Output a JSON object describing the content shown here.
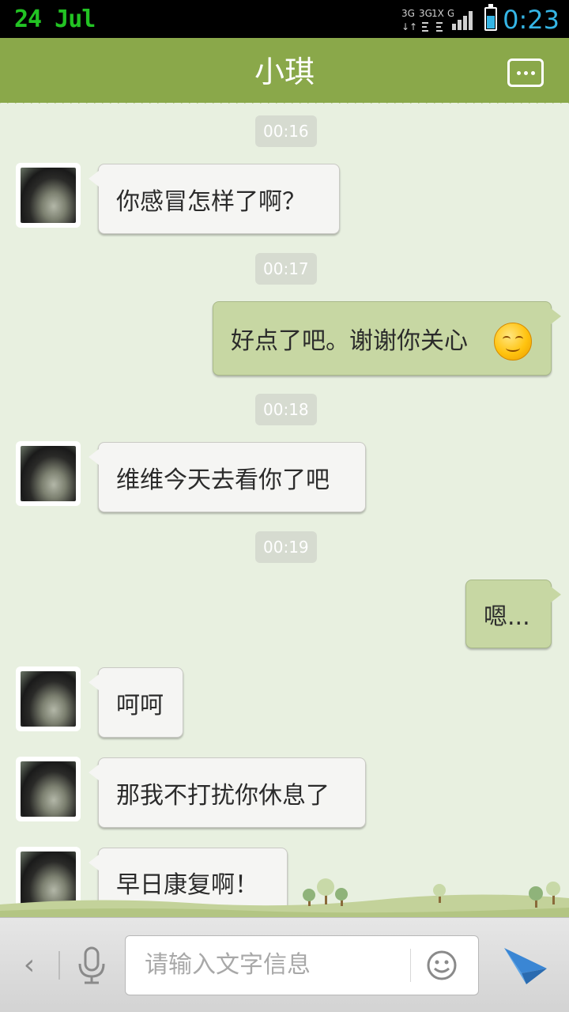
{
  "status_bar": {
    "date": "24  Jul",
    "time": "0:23",
    "network_labels": [
      "3G",
      "3G",
      "1X",
      "G"
    ]
  },
  "header": {
    "title": "小琪",
    "menu_icon": "more-dots-icon"
  },
  "messages": [
    {
      "type": "timestamp",
      "text": "00:16"
    },
    {
      "type": "incoming",
      "text": "你感冒怎样了啊？"
    },
    {
      "type": "timestamp",
      "text": "00:17"
    },
    {
      "type": "outgoing",
      "text": "好点了吧。谢谢你关心",
      "emoji": "smiling-face-emoji"
    },
    {
      "type": "timestamp",
      "text": "00:18"
    },
    {
      "type": "incoming",
      "text": "维维今天去看你了吧"
    },
    {
      "type": "timestamp",
      "text": "00:19"
    },
    {
      "type": "outgoing",
      "text": "嗯..."
    },
    {
      "type": "incoming",
      "text": "呵呵"
    },
    {
      "type": "incoming",
      "text": "那我不打扰你休息了"
    },
    {
      "type": "incoming",
      "text": "早日康复啊！"
    }
  ],
  "input_bar": {
    "placeholder": "请输入文字信息",
    "back_icon": "chevron-left-icon",
    "mic_icon": "microphone-icon",
    "emoji_icon": "smiley-icon",
    "send_icon": "paper-plane-icon"
  },
  "colors": {
    "header_bg": "#8aa84a",
    "chat_bg": "#e8f0e0",
    "outgoing_bubble": "#c7d7a3",
    "incoming_bubble": "#f5f5f3",
    "status_date": "#22c323",
    "status_time": "#35b5e5"
  }
}
